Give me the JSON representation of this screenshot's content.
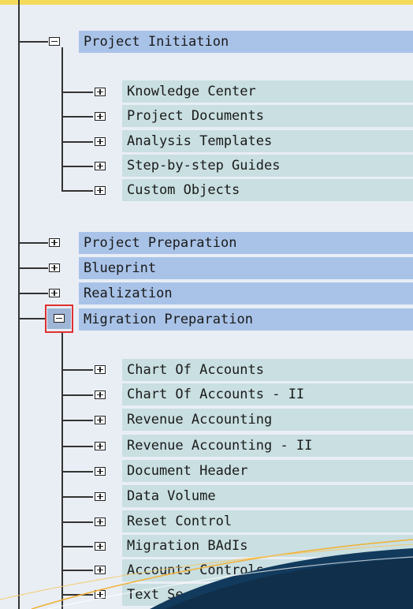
{
  "tree": {
    "phases": [
      {
        "label": "Project Initiation",
        "expanded": true,
        "children": [
          "Knowledge Center",
          "Project Documents",
          "Analysis Templates",
          "Step-by-step Guides",
          "Custom Objects"
        ]
      },
      {
        "label": "Project Preparation",
        "expanded": false,
        "children": []
      },
      {
        "label": "Blueprint",
        "expanded": false,
        "children": []
      },
      {
        "label": "Realization",
        "expanded": false,
        "children": []
      },
      {
        "label": "Migration Preparation",
        "expanded": true,
        "selected": true,
        "children": [
          "Chart Of Accounts",
          "Chart Of Accounts - II",
          "Revenue Accounting",
          "Revenue Accounting - II",
          "Document Header",
          "Data Volume",
          "Reset Control",
          "Migration BAdIs",
          "Accounts Controls",
          "Text Se"
        ]
      }
    ]
  },
  "colors": {
    "phase_row": "#a9c3e8",
    "child_row": "#c9dfe1",
    "selection_border": "#e03030",
    "top_bar": "#f5d95a",
    "corner_dark": "#123a5c",
    "corner_accent": "#f0b23a"
  }
}
